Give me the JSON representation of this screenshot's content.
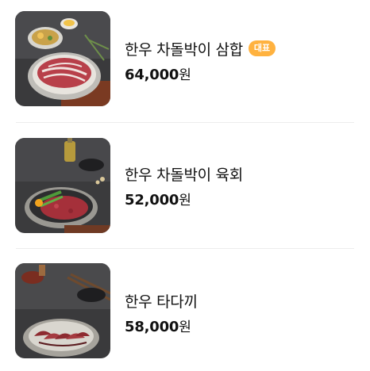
{
  "menu": {
    "items": [
      {
        "name": "한우 차돌박이 삼합",
        "badge": "대표",
        "price_amount": "64,000",
        "price_unit": "원",
        "image_icon": "bulgogi-platter-photo-icon"
      },
      {
        "name": "한우 차돌박이 육회",
        "badge": "",
        "price_amount": "52,000",
        "price_unit": "원",
        "image_icon": "yukhoe-plate-photo-icon"
      },
      {
        "name": "한우 타다끼",
        "badge": "",
        "price_amount": "58,000",
        "price_unit": "원",
        "image_icon": "tataki-plate-photo-icon"
      }
    ]
  },
  "colors": {
    "badge_background": "#ffb23f",
    "badge_text": "#ffffff",
    "text_primary": "#111111",
    "divider": "#ececec"
  }
}
